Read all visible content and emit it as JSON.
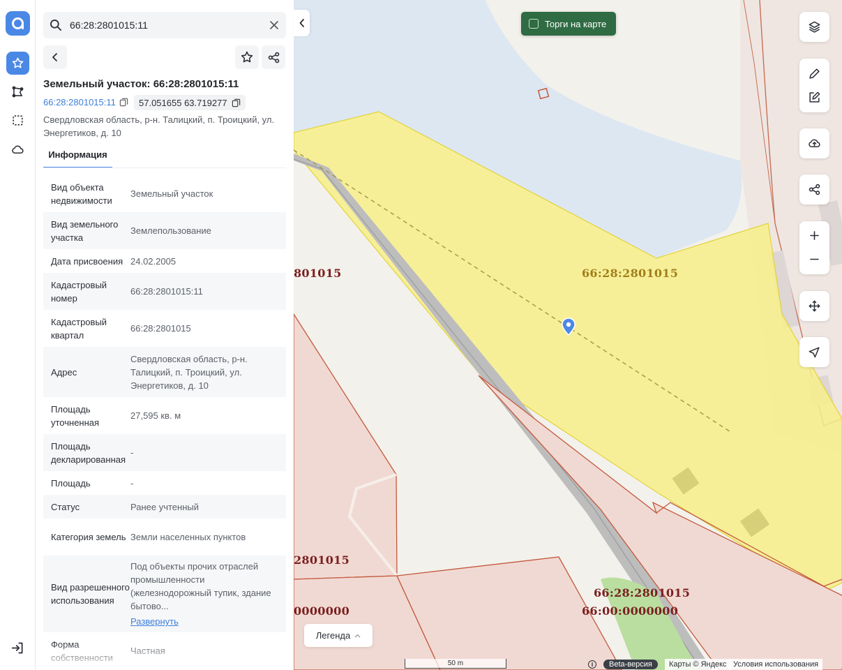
{
  "search": {
    "value": "66:28:2801015:11"
  },
  "object": {
    "title": "Земельный участок: 66:28:2801015:11",
    "cad_number_link": "66:28:2801015:11",
    "coordinates": "57.051655 63.719277",
    "address": "Свердловская область, р-н. Талицкий, п. Троицкий, ул. Энергетиков, д. 10"
  },
  "tabs": [
    {
      "label": "Информация",
      "active": true
    }
  ],
  "info_rows": [
    {
      "key": "Вид объекта недвижимости",
      "value": "Земельный участок"
    },
    {
      "key": "Вид земельного участка",
      "value": "Землепользование"
    },
    {
      "key": "Дата присвоения",
      "value": "24.02.2005"
    },
    {
      "key": "Кадастровый номер",
      "value": "66:28:2801015:11"
    },
    {
      "key": "Кадастровый квартал",
      "value": "66:28:2801015"
    },
    {
      "key": "Адрес",
      "value": "Свердловская область, р-н. Талицкий, п. Троицкий, ул. Энергетиков, д. 10"
    },
    {
      "key": "Площадь уточненная",
      "value": "27,595 кв. м"
    },
    {
      "key": "Площадь декларированная",
      "value": "-"
    },
    {
      "key": "Площадь",
      "value": "-"
    },
    {
      "key": "Статус",
      "value": "Ранее учтенный"
    },
    {
      "key": "Категория земель",
      "value": "Земли населенных пунктов"
    },
    {
      "key": "Вид разрешенного использования",
      "value": "Под объекты прочих отраслей промышленности (железнодорожный тупик, здание бытово...",
      "expand_label": "Развернуть"
    },
    {
      "key": "Форма собственности",
      "value": "Частная"
    }
  ],
  "map": {
    "torgi_label": "Торги на карте",
    "legend_label": "Легенда",
    "labels": {
      "left_top": "801015",
      "center": "66:28:2801015",
      "left_mid": "2801015",
      "left_bottom": "0000000",
      "bottom_1": "66:28:2801015",
      "bottom_2": "66:00:0000000"
    },
    "scale_label": "50 m",
    "info_glyph": "i",
    "beta_label": "Beta-версия",
    "copyright": "Карты © Яндекс",
    "terms": "Условия использования"
  },
  "colors": {
    "accent": "#4a88e6",
    "parcel_fill": "#f7ef8a",
    "water": "#dde7f2",
    "torgi_bg": "#2f6b43"
  }
}
